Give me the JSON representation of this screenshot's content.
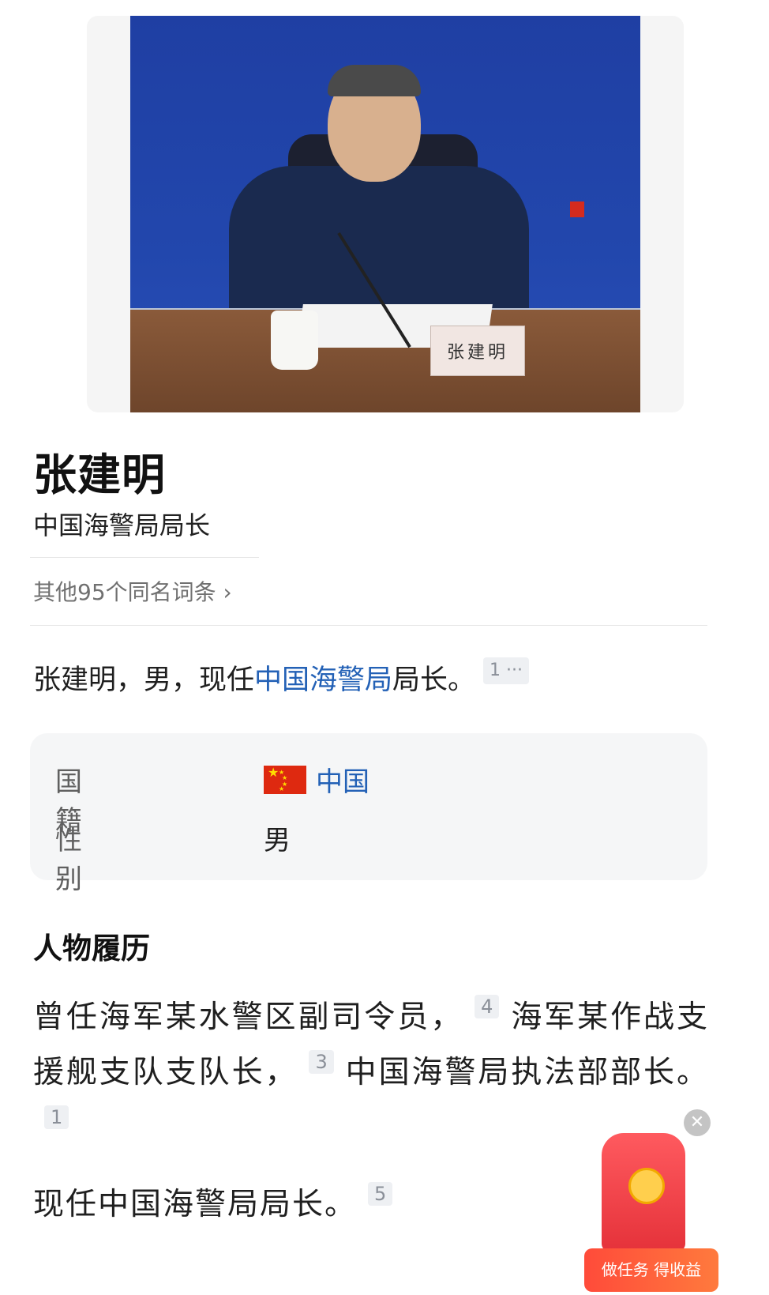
{
  "photo": {
    "nameplate": "张建明"
  },
  "entry": {
    "title": "张建明",
    "subtitle": "中国海警局局长",
    "same_name_link": "其他95个同名词条 ›"
  },
  "summary": {
    "text_before": "张建明，男，现任",
    "link": "中国海警局",
    "text_after": "局长。",
    "ref": "1 ···"
  },
  "infobox": {
    "rows": [
      {
        "key": "国籍",
        "value": "中国"
      },
      {
        "key": "性别",
        "value": "男"
      }
    ]
  },
  "career": {
    "section_title": "人物履历",
    "p1_part1": "曾任海军某水警区副司令员，",
    "p1_ref1": "4",
    "p1_part2": "海军某作战支援舰支队支队长，",
    "p1_ref2": "3",
    "p1_part3": "中国海警局执法部部长。",
    "p1_ref3": "1",
    "p2_text": "现任中国海警局局长。",
    "p2_ref": "5"
  },
  "floating": {
    "close_label": "✕",
    "banner_label": "做任务 得收益"
  },
  "colors": {
    "link": "#2361b6",
    "flag_red": "#de2910",
    "flag_yellow": "#ffde00",
    "photo_backdrop": "#2247ad"
  },
  "icons": {
    "chevron": "chevron-right-icon",
    "flag": "china-flag-icon",
    "close": "close-icon"
  }
}
